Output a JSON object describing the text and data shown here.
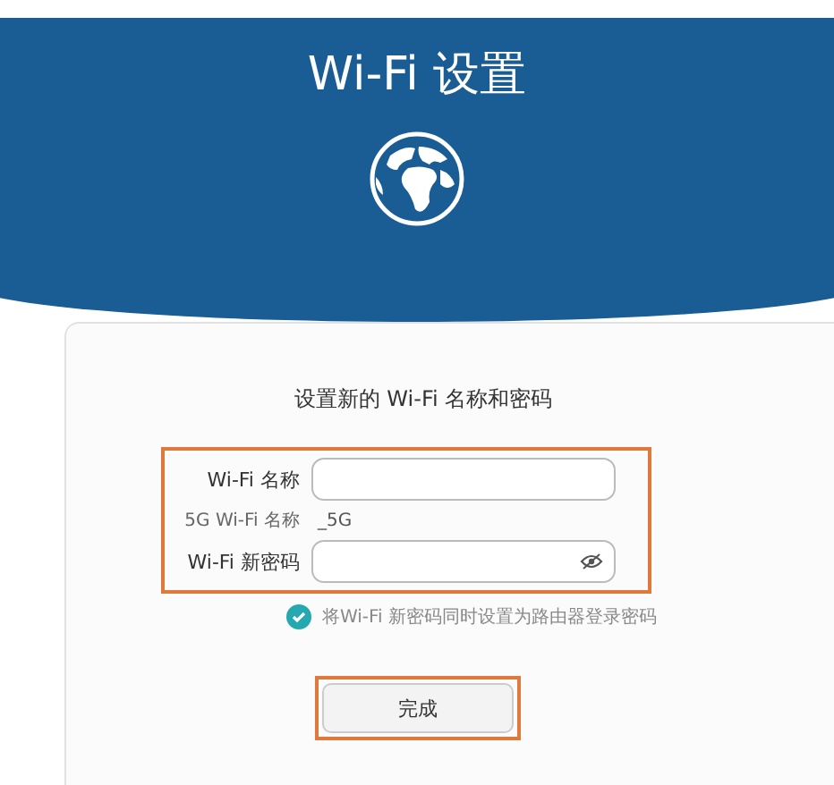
{
  "header": {
    "title": "Wi-Fi 设置"
  },
  "form": {
    "heading": "设置新的 Wi-Fi 名称和密码",
    "fields": [
      {
        "kind": "input",
        "label": "Wi-Fi 名称"
      },
      {
        "kind": "text",
        "label": "5G Wi-Fi 名称",
        "value": "_5G"
      },
      {
        "kind": "password",
        "label": "Wi-Fi 新密码"
      }
    ],
    "option": {
      "label": "将Wi-Fi 新密码同时设置为路由器登录密码",
      "checked": true
    },
    "button": "完成"
  }
}
